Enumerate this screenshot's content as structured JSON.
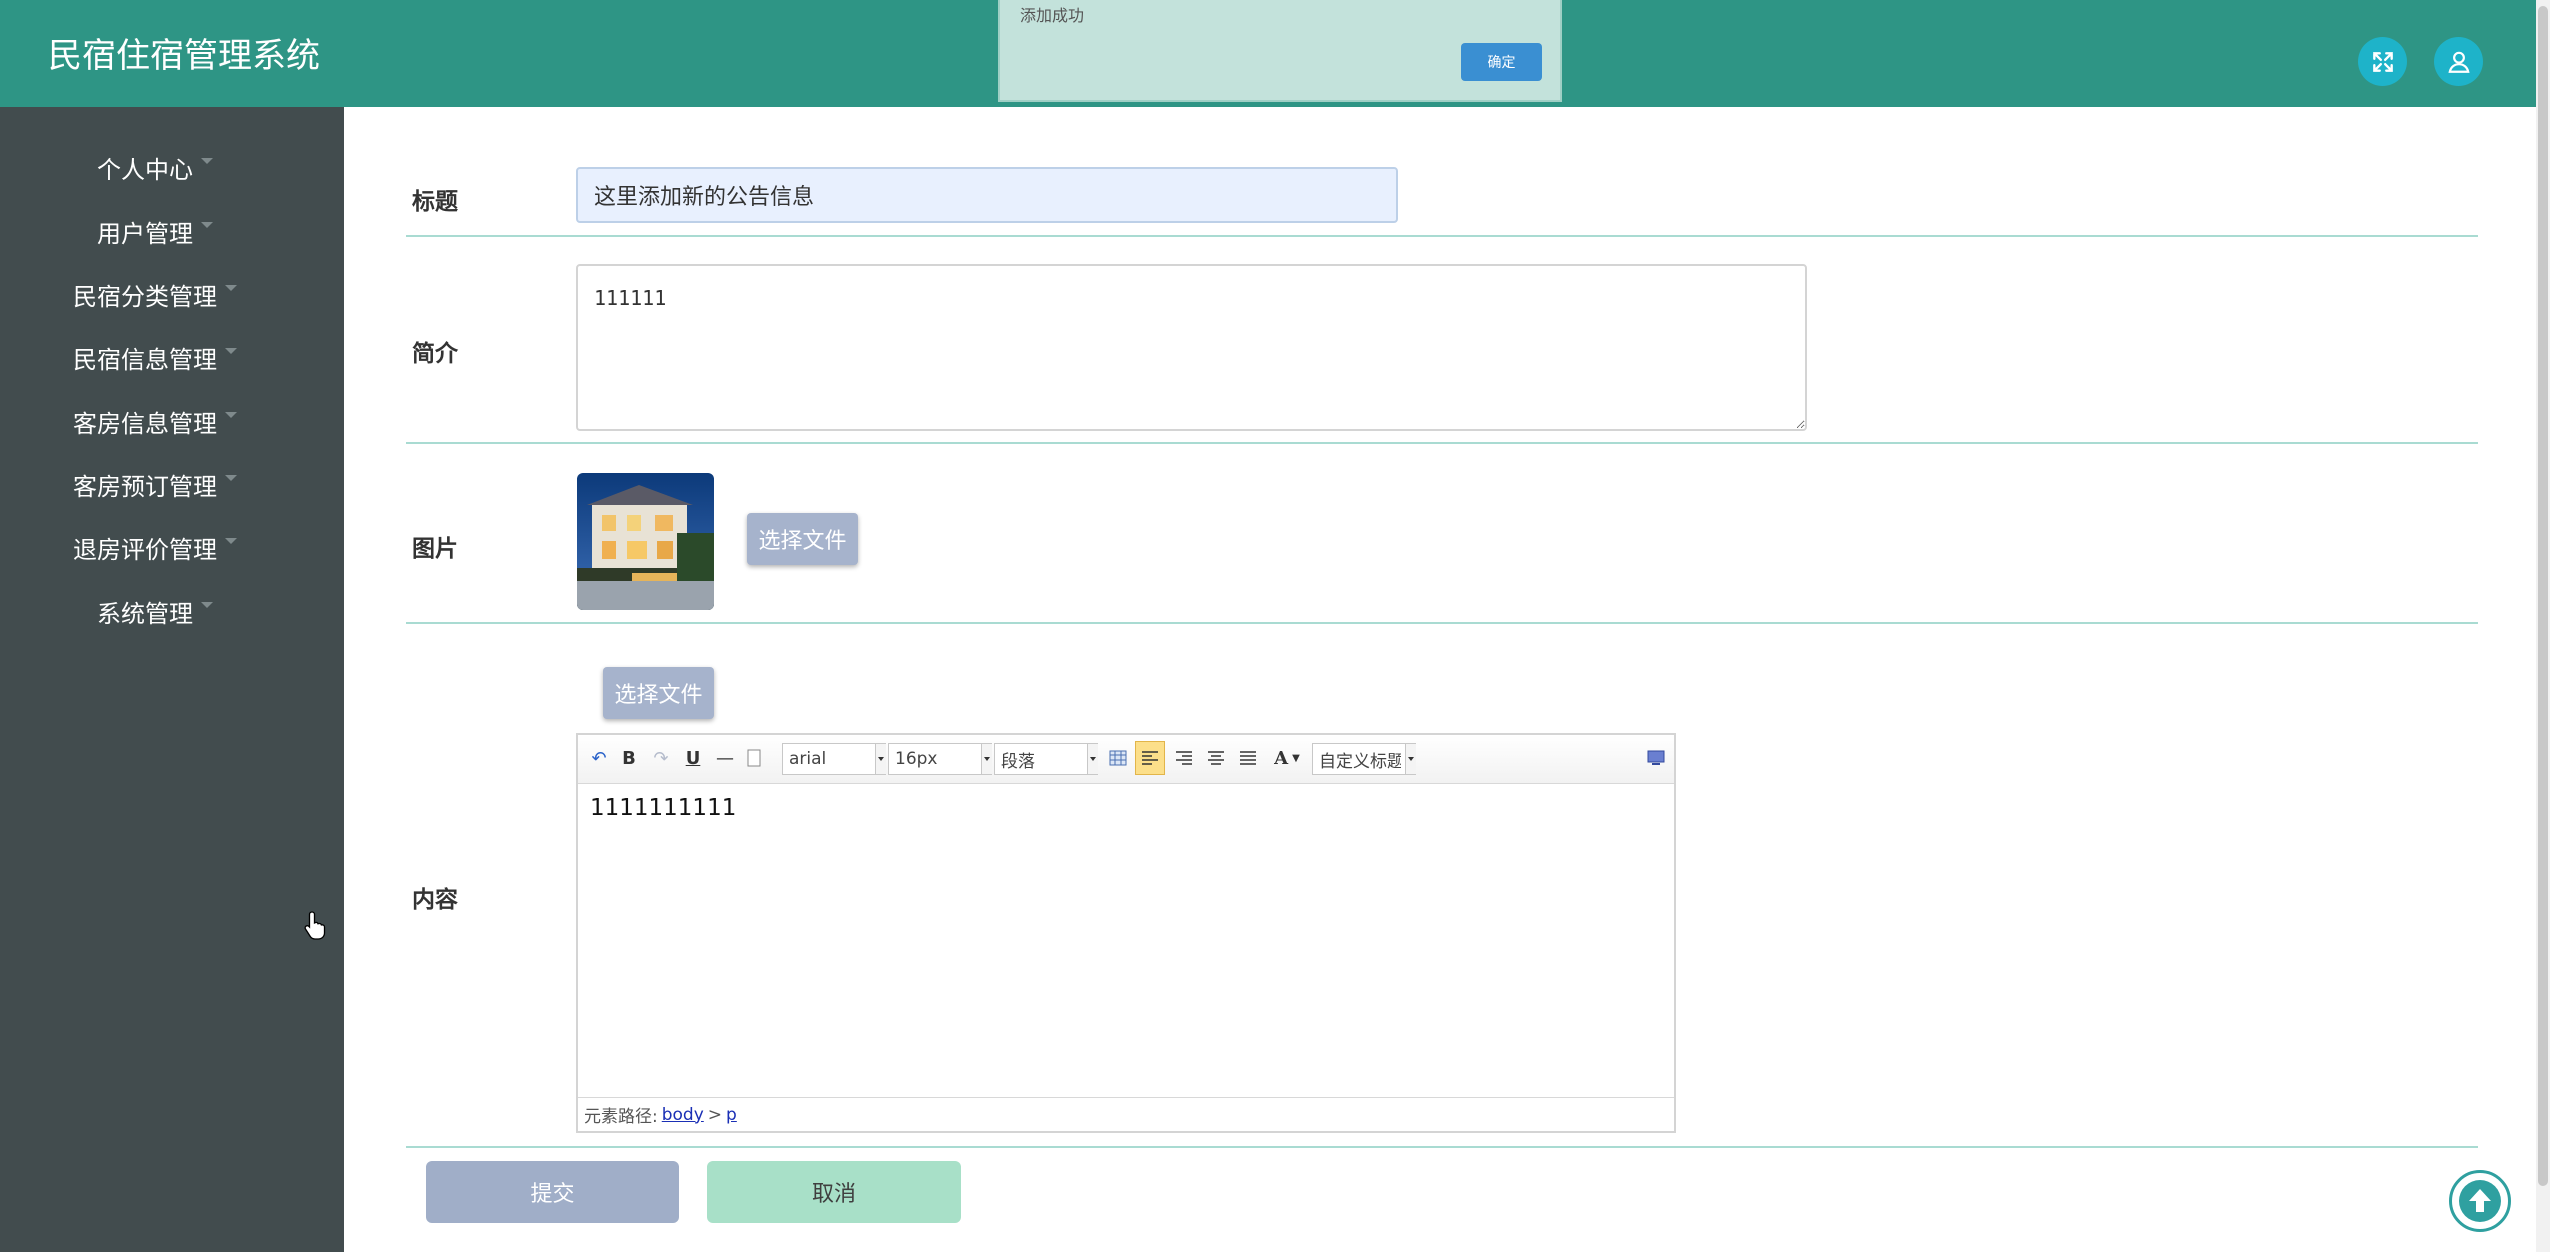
{
  "app": {
    "title": "民宿住宿管理系统"
  },
  "header": {
    "fullscreen_icon": "expand-icon",
    "user_icon": "user-icon",
    "accent_color": "#2e9585"
  },
  "alert": {
    "message": "添加成功",
    "confirm_label": "确定"
  },
  "sidebar": {
    "items": [
      {
        "label": "个人中心"
      },
      {
        "label": "用户管理"
      },
      {
        "label": "民宿分类管理"
      },
      {
        "label": "民宿信息管理"
      },
      {
        "label": "客房信息管理"
      },
      {
        "label": "客房预订管理"
      },
      {
        "label": "退房评价管理"
      },
      {
        "label": "系统管理"
      }
    ]
  },
  "form": {
    "title_label": "标题",
    "title_value": "这里添加新的公告信息",
    "intro_label": "简介",
    "intro_value": "111111",
    "image_label": "图片",
    "image_upload_label": "选择文件",
    "content_label": "内容",
    "content_upload_label": "选择文件",
    "submit_label": "提交",
    "cancel_label": "取消"
  },
  "editor": {
    "font_family": "arial",
    "font_size": "16px",
    "paragraph": "段落",
    "custom_heading": "自定义标题",
    "body_text": "1111111111",
    "path_prefix": "元素路径:",
    "path_body": "body",
    "path_sep": ">",
    "path_p": "p"
  }
}
